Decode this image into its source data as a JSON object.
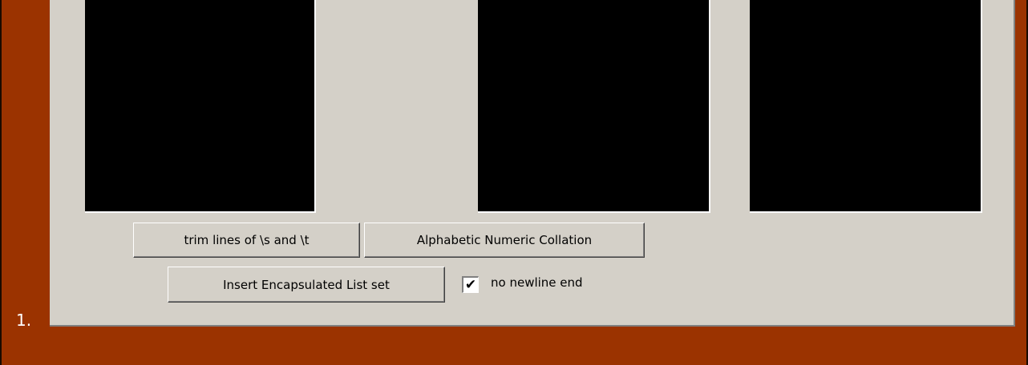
{
  "list_marker": "1.",
  "buttons": {
    "trim": "trim lines of \\s and \\t",
    "alpha": "Alphabetic Numeric Collation",
    "insert": "Insert Encapsulated List set"
  },
  "checkbox": {
    "label": "no newline end",
    "checked": true,
    "mark": "✔"
  },
  "colors": {
    "background": "#9b3300",
    "panel": "#d4d0c8",
    "text_area": "#000000"
  }
}
